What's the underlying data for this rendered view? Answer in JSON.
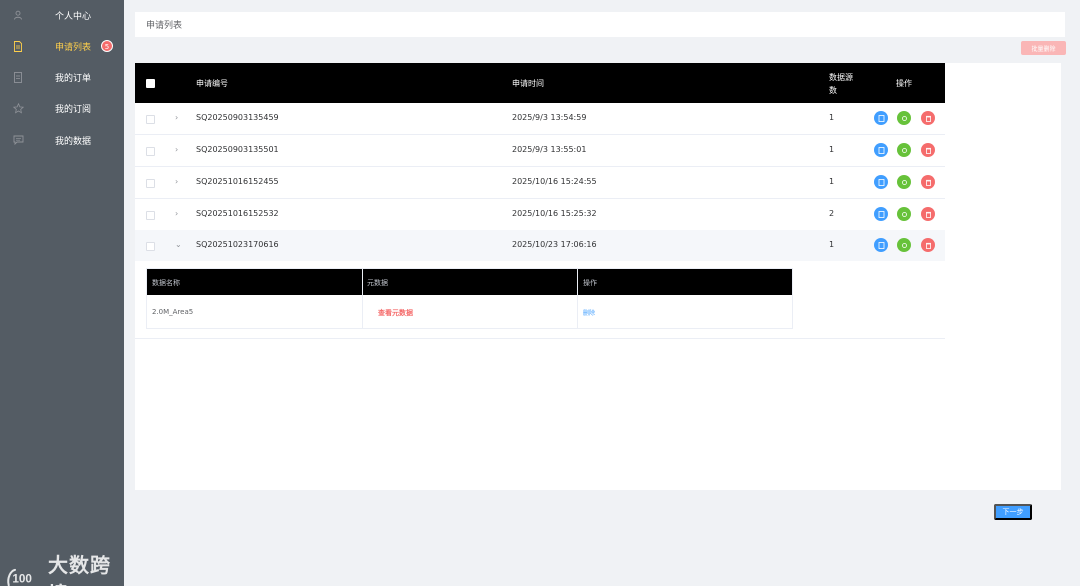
{
  "sidebar": {
    "items": [
      {
        "label": "个人中心",
        "icon": "user-icon"
      },
      {
        "label": "申请列表",
        "icon": "document-icon",
        "badge": "5"
      },
      {
        "label": "我的订单",
        "icon": "order-icon"
      },
      {
        "label": "我的订阅",
        "icon": "star-icon"
      },
      {
        "label": "我的数据",
        "icon": "message-icon"
      }
    ],
    "active_index": 1,
    "brand": "大数跨境"
  },
  "header": {
    "title": "申请列表"
  },
  "toolbar": {
    "batch_delete_label": "批量删除"
  },
  "table": {
    "columns": [
      "申请编号",
      "申请时间",
      "数据源数",
      "操作"
    ],
    "rows": [
      {
        "id": "SQ20250903135459",
        "time": "2025/9/3 13:54:59",
        "count": "1"
      },
      {
        "id": "SQ20250903135501",
        "time": "2025/9/3 13:55:01",
        "count": "1"
      },
      {
        "id": "SQ20251016152455",
        "time": "2025/10/16 15:24:55",
        "count": "1"
      },
      {
        "id": "SQ20251016152532",
        "time": "2025/10/16 15:25:32",
        "count": "2"
      },
      {
        "id": "SQ20251023170616",
        "time": "2025/10/23 17:06:16",
        "count": "1"
      }
    ],
    "expanded_index": 4
  },
  "subtable": {
    "columns": [
      "数据名称",
      "元数据",
      "操作"
    ],
    "rows": [
      {
        "name": "2.0M_Area5",
        "meta_link": "查看元数据",
        "action": "删除"
      }
    ]
  },
  "footer": {
    "next_label": "下一步"
  },
  "colors": {
    "sidebar_bg": "#545c64",
    "active_text": "#ffd04b",
    "primary": "#409eff",
    "success": "#67c23a",
    "danger": "#f56c6c"
  }
}
